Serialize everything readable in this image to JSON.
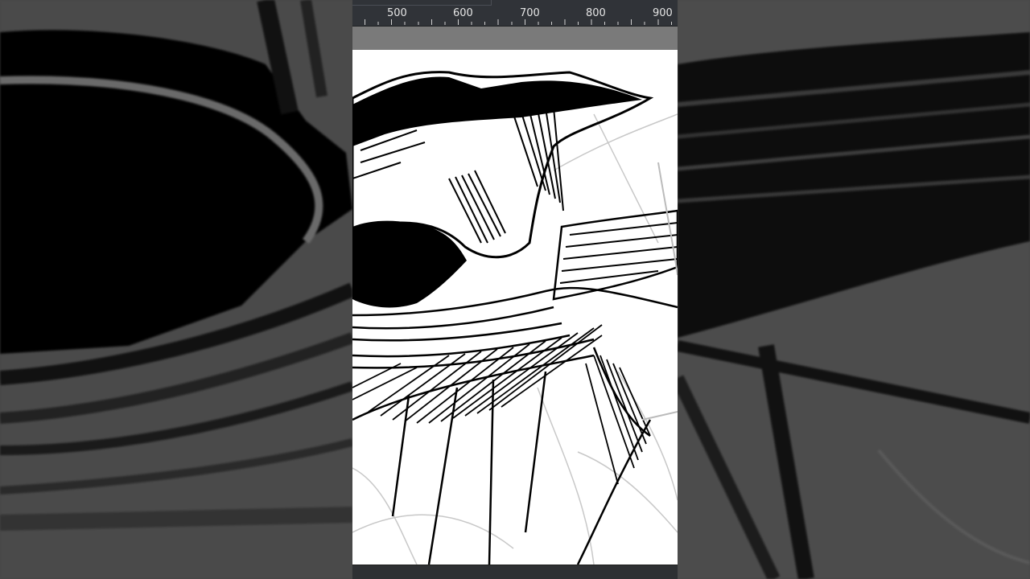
{
  "ruler": {
    "unit_labels": [
      "500",
      "600",
      "700",
      "800",
      "900"
    ]
  },
  "canvas": {
    "subject": "ink-sketch-hooded-figure"
  },
  "colors": {
    "ruler_bg": "#303338",
    "workspace_gray": "#7a7a7a",
    "canvas_bg": "#ffffff",
    "ink": "#000000"
  }
}
